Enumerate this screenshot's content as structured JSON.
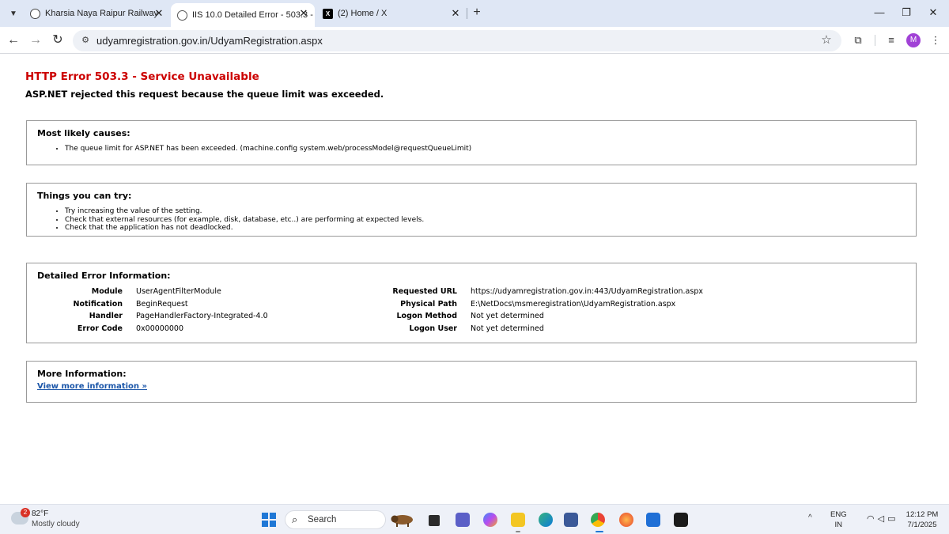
{
  "tabs": [
    {
      "title": "Kharsia Naya Raipur Railway",
      "favicon": "railway-globe-icon",
      "active": false
    },
    {
      "title": "IIS 10.0 Detailed Error - 503.3 -",
      "favicon": "globe-icon",
      "active": true
    },
    {
      "title": "(2) Home / X",
      "favicon": "x-logo-icon",
      "active": false
    }
  ],
  "address_bar": {
    "url": "udyamregistration.gov.in/UdyamRegistration.aspx"
  },
  "profile": {
    "initial": "M",
    "color": "#a142d6"
  },
  "error_page": {
    "title": "HTTP Error 503.3 - Service Unavailable",
    "subtitle": "ASP.NET rejected this request because the queue limit was exceeded.",
    "causes": {
      "heading": "Most likely causes:",
      "items": [
        "The queue limit for ASP.NET has been exceeded. (machine.config system.web/processModel@requestQueueLimit)"
      ]
    },
    "try": {
      "heading": "Things you can try:",
      "items": [
        "Try increasing the value of the setting.",
        "Check that external resources (for example, disk, database, etc..) are performing at expected levels.",
        "Check that the application has not deadlocked."
      ]
    },
    "details": {
      "heading": "Detailed Error Information:",
      "left": [
        {
          "key": "Module",
          "value": "UserAgentFilterModule"
        },
        {
          "key": "Notification",
          "value": "BeginRequest"
        },
        {
          "key": "Handler",
          "value": "PageHandlerFactory-Integrated-4.0"
        },
        {
          "key": "Error Code",
          "value": "0x00000000"
        }
      ],
      "right": [
        {
          "key": "Requested URL",
          "value": "https://udyamregistration.gov.in:443/UdyamRegistration.aspx"
        },
        {
          "key": "Physical Path",
          "value": "E:\\NetDocs\\msmeregistration\\UdyamRegistration.aspx"
        },
        {
          "key": "Logon Method",
          "value": "Not yet determined"
        },
        {
          "key": "Logon User",
          "value": "Not yet determined"
        }
      ]
    },
    "more": {
      "heading": "More Information:",
      "link": "View more information »"
    }
  },
  "taskbar": {
    "weather": {
      "temp": "82°F",
      "desc": "Mostly cloudy",
      "badge": "2"
    },
    "search_label": "Search",
    "lang": {
      "line1": "ENG",
      "line2": "IN"
    },
    "clock": {
      "time": "12:12 PM",
      "date": "7/1/2025"
    }
  }
}
